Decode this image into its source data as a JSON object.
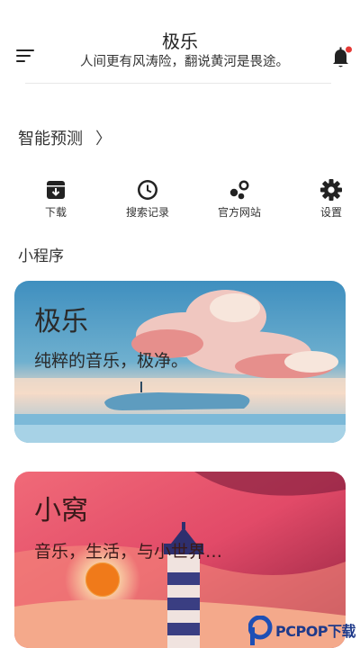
{
  "header": {
    "title": "极乐",
    "subtitle": "人间更有风涛险，翻说黄河是畏途。",
    "menu_icon": "menu-icon",
    "notification_icon": "bell-icon",
    "notification_dot_color": "#e53935"
  },
  "predict": {
    "label": "智能预测",
    "chevron": "〉"
  },
  "actions": [
    {
      "label": "下载",
      "icon": "download-icon"
    },
    {
      "label": "搜索记录",
      "icon": "clock-icon"
    },
    {
      "label": "官方网站",
      "icon": "web-icon"
    },
    {
      "label": "设置",
      "icon": "gear-icon"
    }
  ],
  "mini_programs": {
    "section_title": "小程序",
    "cards": [
      {
        "title": "极乐",
        "subtitle": "纯粹的音乐，极净。"
      },
      {
        "title": "小窝",
        "subtitle": "音乐，生活，与小世界…"
      }
    ]
  },
  "watermark": {
    "text": "PCPOP下载"
  }
}
